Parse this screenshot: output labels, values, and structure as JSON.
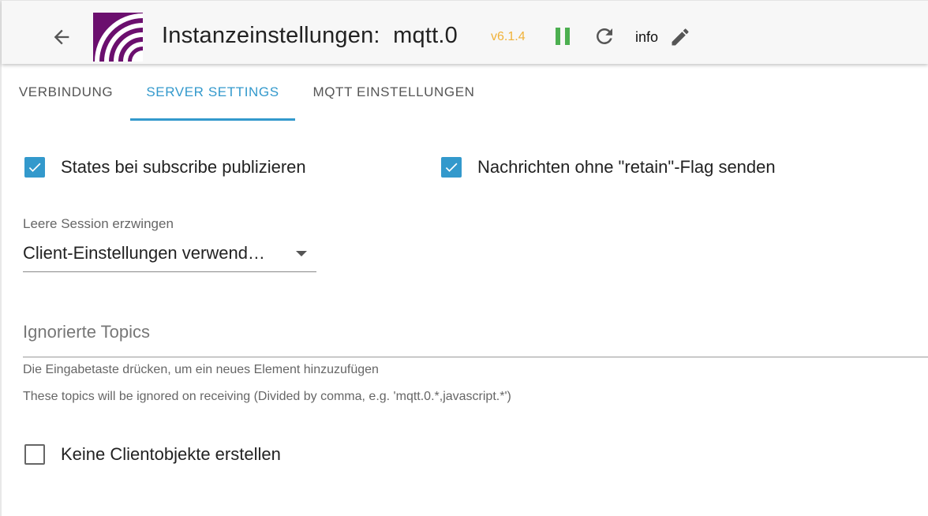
{
  "header": {
    "title": "Instanzeinstellungen:  mqtt.0",
    "version": "v6.1.4",
    "log_level": "info",
    "colors": {
      "version": "#f0b23a",
      "running": "#4caf50",
      "logo_bg": "#6b0f6e",
      "accent": "#3399cc"
    },
    "icons": [
      "arrow-back-icon",
      "mqtt-logo",
      "pause-icon",
      "reload-icon",
      "edit-icon"
    ]
  },
  "tabs": [
    {
      "label": "VERBINDUNG",
      "active": false
    },
    {
      "label": "SERVER SETTINGS",
      "active": true
    },
    {
      "label": "MQTT EINSTELLUNGEN",
      "active": false
    }
  ],
  "form": {
    "publish_on_subscribe": {
      "label": "States bei subscribe publizieren",
      "checked": true
    },
    "send_without_retain": {
      "label": "Nachrichten ohne \"retain\"-Flag senden",
      "checked": true
    },
    "force_clean_session": {
      "label": "Leere Session erzwingen",
      "value": "Client-Einstellungen verwend…"
    },
    "ignored_topics": {
      "placeholder": "Ignorierte Topics",
      "help": "Die Eingabetaste drücken, um ein neues Element hinzuzufügen",
      "description": "These topics will be ignored on receiving (Divided by comma, e.g. 'mqtt.0.*,javascript.*')"
    },
    "no_client_objects": {
      "label": "Keine Clientobjekte erstellen",
      "checked": false
    }
  }
}
